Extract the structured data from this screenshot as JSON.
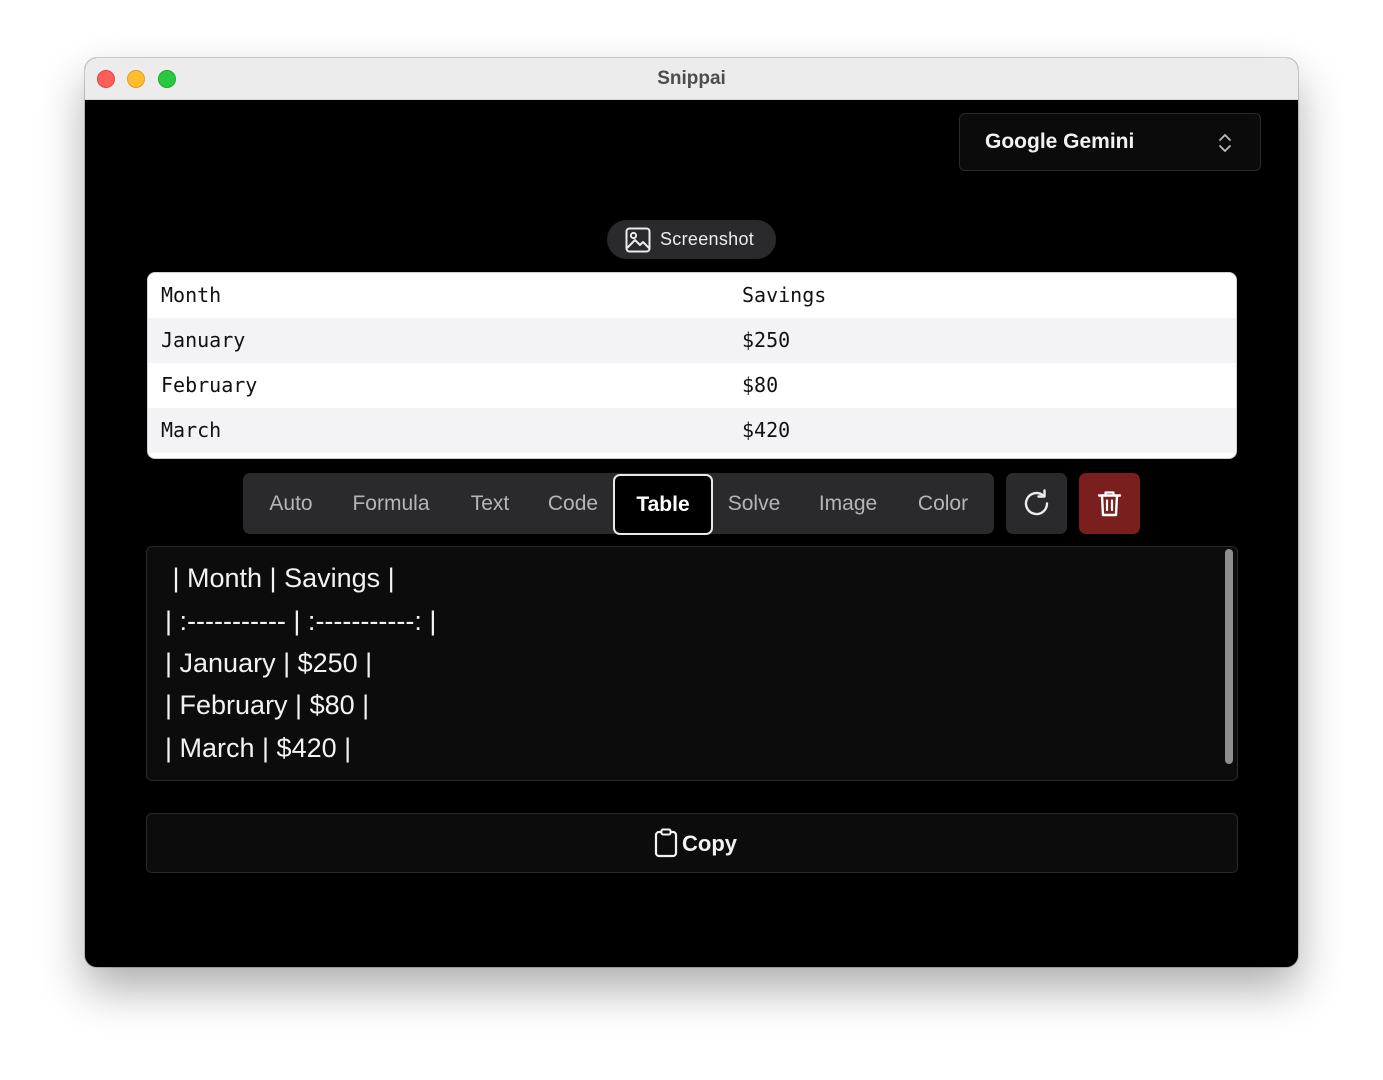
{
  "window": {
    "title": "Snippai"
  },
  "model_select": {
    "value": "Google Gemini",
    "icon": "chevron-up-down-icon"
  },
  "screenshot_button": {
    "label": "Screenshot",
    "icon": "image-icon"
  },
  "rendered_table": {
    "headers": [
      "Month",
      "Savings"
    ],
    "rows": [
      [
        "January",
        "$250"
      ],
      [
        "February",
        "$80"
      ],
      [
        "March",
        "$420"
      ]
    ]
  },
  "modes": {
    "items": [
      "Auto",
      "Formula",
      "Text",
      "Code",
      "Table",
      "Solve",
      "Image",
      "Color"
    ],
    "selected": "Table"
  },
  "actions": {
    "refresh_icon": "refresh-icon",
    "delete_icon": "trash-icon",
    "delete_color": "#7b1e1e"
  },
  "output": {
    "lines": [
      " | Month | Savings |",
      "| :----------- | :-----------: |",
      "| January | $250 |",
      "| February | $80 |",
      "| March | $420 |"
    ]
  },
  "copy_button": {
    "label": "Copy",
    "icon": "clipboard-icon"
  }
}
